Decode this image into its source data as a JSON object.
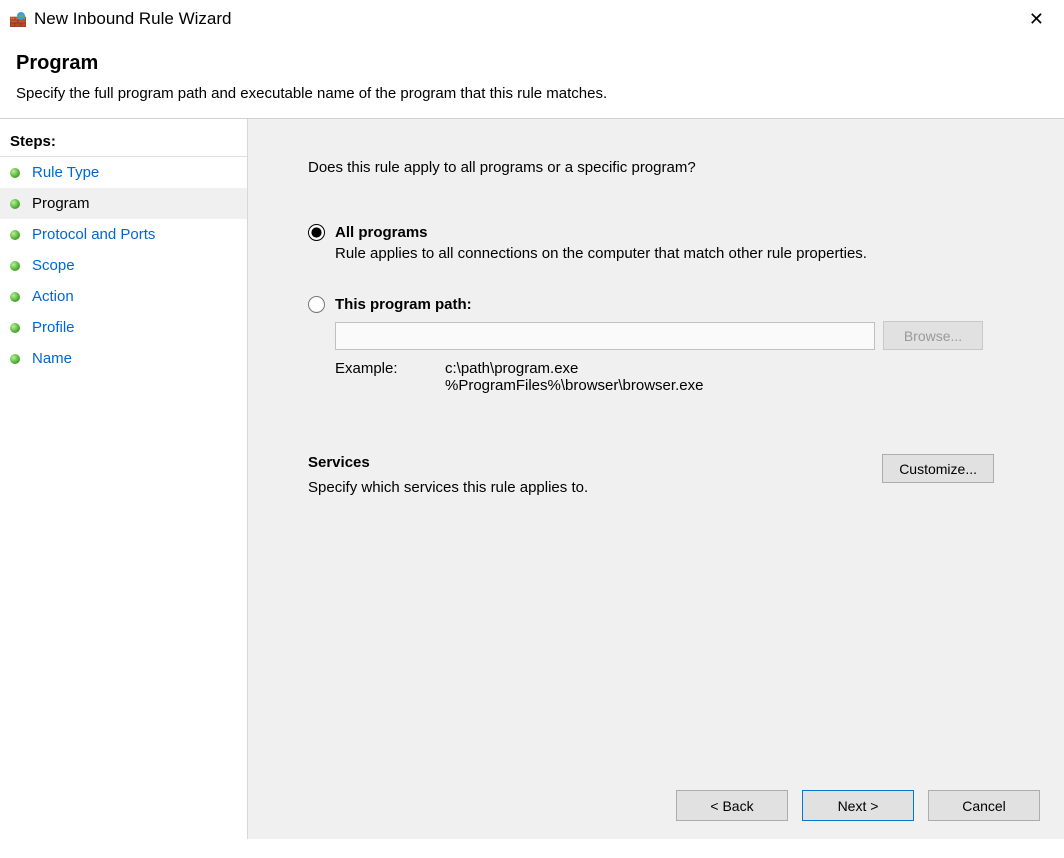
{
  "titlebar": {
    "title": "New Inbound Rule Wizard"
  },
  "header": {
    "heading": "Program",
    "subtitle": "Specify the full program path and executable name of the program that this rule matches."
  },
  "sidebar": {
    "steps_label": "Steps:",
    "items": [
      {
        "label": "Rule Type",
        "current": false
      },
      {
        "label": "Program",
        "current": true
      },
      {
        "label": "Protocol and Ports",
        "current": false
      },
      {
        "label": "Scope",
        "current": false
      },
      {
        "label": "Action",
        "current": false
      },
      {
        "label": "Profile",
        "current": false
      },
      {
        "label": "Name",
        "current": false
      }
    ]
  },
  "content": {
    "question": "Does this rule apply to all programs or a specific program?",
    "option_all": {
      "label": "All programs",
      "desc": "Rule applies to all connections on the computer that match other rule properties."
    },
    "option_path": {
      "label": "This program path:",
      "input_value": "",
      "browse_label": "Browse...",
      "example_label": "Example:",
      "example_text": "c:\\path\\program.exe\n%ProgramFiles%\\browser\\browser.exe"
    },
    "services": {
      "heading": "Services",
      "desc": "Specify which services this rule applies to.",
      "customize_label": "Customize..."
    }
  },
  "footer": {
    "back": "< Back",
    "next": "Next >",
    "cancel": "Cancel"
  }
}
